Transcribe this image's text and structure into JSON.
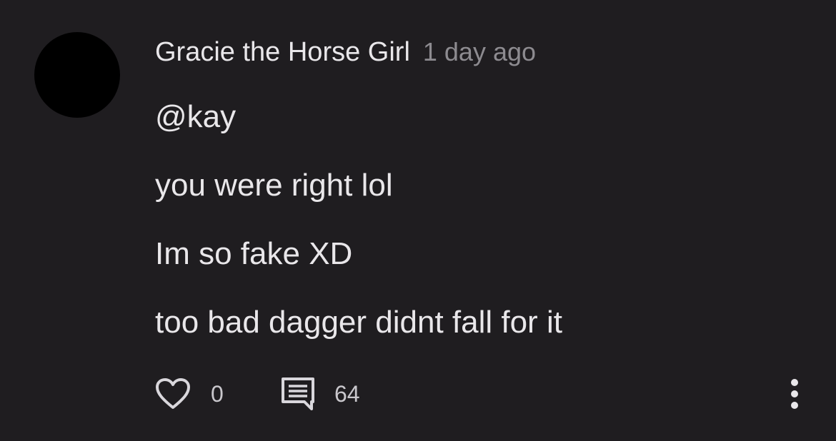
{
  "comment": {
    "author": "Gracie the Horse Girl",
    "timestamp": "1 day ago",
    "lines": [
      "@kay",
      "you were right lol",
      "Im so fake XD",
      "too bad dagger didnt fall for it"
    ],
    "likes": "0",
    "replies": "64",
    "icons": {
      "like": "heart-icon",
      "reply": "comment-icon",
      "more": "more-vertical-icon"
    }
  },
  "colors": {
    "background": "#1f1d20",
    "text": "#e9e7ea",
    "muted": "#8d8b90",
    "avatar": "#000000"
  }
}
